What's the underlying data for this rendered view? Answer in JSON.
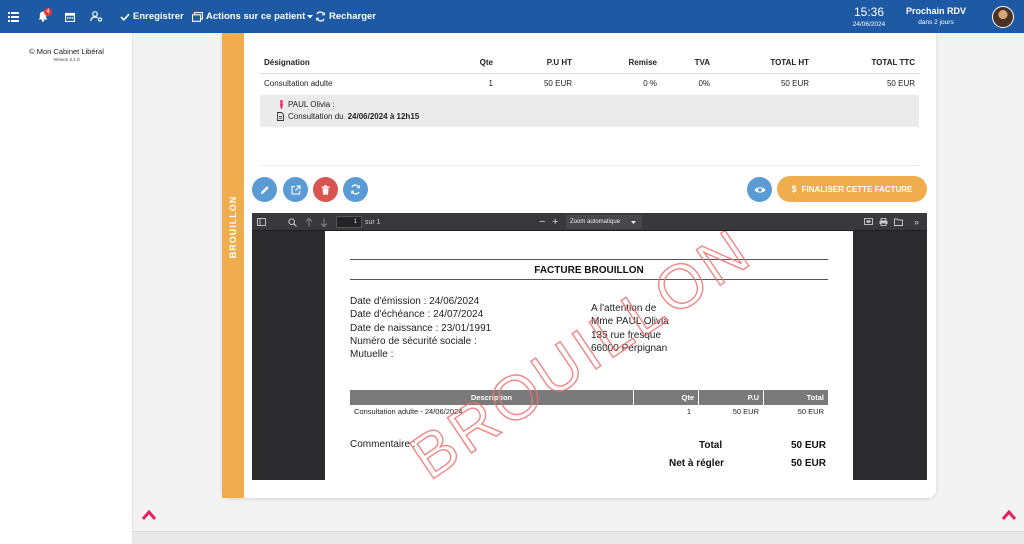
{
  "topbar": {
    "notification_count": "4",
    "save_label": "Enregistrer",
    "actions_label": "Actions sur ce patient",
    "reload_label": "Recharger",
    "time": "15:36",
    "date": "24/06/2024",
    "next_rdv_label": "Prochain RDV",
    "next_rdv_when": "dans 2 jours"
  },
  "sidebar": {
    "brand": "© Mon Cabinet Libéral",
    "version": "Version 2.1.0"
  },
  "status_label": "BROUILLON",
  "invoice_lines": {
    "headers": [
      "Désignation",
      "Qte",
      "P.U HT",
      "Remise",
      "TVA",
      "TOTAL HT",
      "TOTAL TTC"
    ],
    "rows": [
      [
        "Consultation adulte",
        "1",
        "50 EUR",
        "0 %",
        "0%",
        "50 EUR",
        "50 EUR"
      ]
    ],
    "detail_patient": "PAUL Olivia :",
    "detail_consult_prefix": "Consultation du",
    "detail_consult_date": "24/06/2024 à 12h15"
  },
  "actions": {
    "finalise_label": "FINALISER CETTE FACTURE"
  },
  "viewer": {
    "page_number": "1",
    "page_total": "sur 1",
    "zoom": "Zoom automatique"
  },
  "pdf": {
    "title": "FACTURE BROUILLON",
    "left_lines": [
      "Date d'émission : 24/06/2024",
      "Date d'échéance : 24/07/2024",
      "Date de naissance : 23/01/1991",
      "Numéro de sécurité sociale :",
      "Mutuelle :"
    ],
    "right_lines": [
      "A l'attention de",
      "Mme PAUL Olivia",
      "135 rue fresque",
      "66000 Perpignan"
    ],
    "table_headers": [
      "Description",
      "Qte",
      "P.U",
      "Total"
    ],
    "table_row": [
      "Consultation adulte - 24/06/2024",
      "1",
      "50 EUR",
      "50 EUR"
    ],
    "comment_label": "Commentaire :",
    "total_label": "Total",
    "total_value": "50 EUR",
    "net_label": "Net à régler",
    "net_value": "50 EUR",
    "watermark": "BROUILLON"
  },
  "colors": {
    "topbar": "#1d5aa3",
    "draft": "#f0ad4e",
    "action_blue": "#5b9bd5",
    "delete_red": "#d9534f",
    "accent_pink": "#e91e63"
  }
}
